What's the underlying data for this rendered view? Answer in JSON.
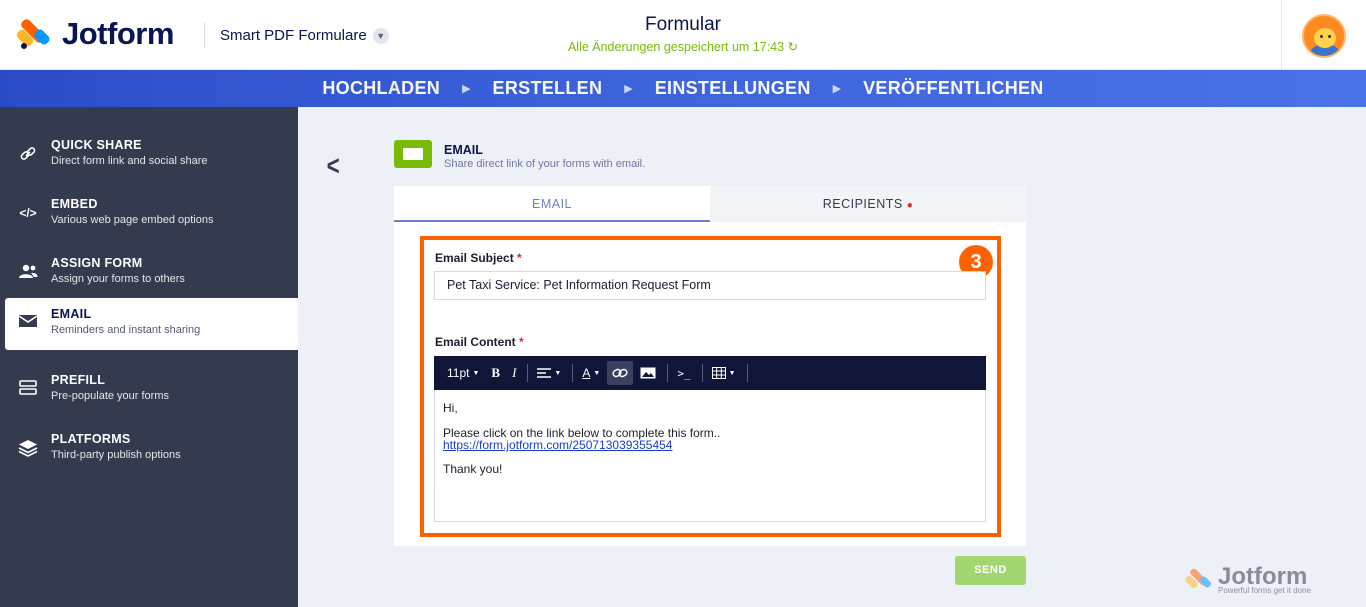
{
  "header": {
    "brand": "Jotform",
    "form_type": "Smart PDF Formulare",
    "title": "Formular",
    "saved_status": "Alle Änderungen gespeichert um 17:43",
    "saved_icon": "↻"
  },
  "steps": [
    "HOCHLADEN",
    "ERSTELLEN",
    "EINSTELLUNGEN",
    "VERÖFFENTLICHEN"
  ],
  "sidebar": {
    "items": [
      {
        "title": "QUICK SHARE",
        "subtitle": "Direct form link and social share",
        "icon": "link-icon"
      },
      {
        "title": "EMBED",
        "subtitle": "Various web page embed options",
        "icon": "code-icon"
      },
      {
        "title": "ASSIGN FORM",
        "subtitle": "Assign your forms to others",
        "icon": "users-icon"
      },
      {
        "title": "EMAIL",
        "subtitle": "Reminders and instant sharing",
        "icon": "envelope-icon",
        "active": true
      },
      {
        "title": "PREFILL",
        "subtitle": "Pre-populate your forms",
        "icon": "prefill-icon"
      },
      {
        "title": "PLATFORMS",
        "subtitle": "Third-party publish options",
        "icon": "layers-icon"
      }
    ]
  },
  "panel": {
    "title": "EMAIL",
    "subtitle": "Share direct link of your forms with email.",
    "tabs": [
      "EMAIL",
      "RECIPIENTS"
    ],
    "active_tab": "EMAIL"
  },
  "form": {
    "subject_label": "Email Subject",
    "subject_value": "Pet Taxi Service: Pet Information Request Form",
    "content_label": "Email Content",
    "required_mark": "*",
    "toolbar_font_size": "11pt",
    "content": {
      "greeting": "Hi,",
      "line": "Please click on the link below to complete this form..",
      "link": "https://form.jotform.com/250713039355454",
      "closing": "Thank you!"
    }
  },
  "step_badge": "3",
  "send_label": "SEND",
  "watermark": {
    "brand": "Jotform",
    "tagline": "Powerful forms get it done"
  },
  "colors": {
    "accent": "#ff6100",
    "nav_blue": "#2b4cc7",
    "sidebar_bg": "#343b4f",
    "saved_green": "#78bb07",
    "send_green": "#a3d670"
  }
}
